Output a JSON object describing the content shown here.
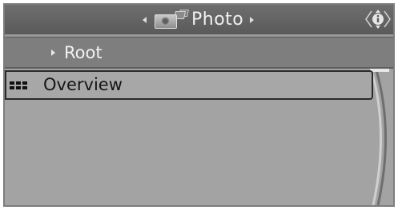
{
  "header": {
    "title": "Photo",
    "icon": "camera-with-cards-icon",
    "left_arrow_icon": "triangle-left-icon",
    "right_arrow_icon": "triangle-right-icon",
    "info_icon": "info-icon"
  },
  "breadcrumb": {
    "label": "Root",
    "icon": "triangle-right-icon"
  },
  "list": {
    "items": [
      {
        "label": "Overview",
        "icon": "grid-view-icon",
        "selected": true
      }
    ]
  },
  "colors": {
    "background": "#9a9a9a",
    "titlebar": "#5f5f5f",
    "breadcrumb_bar": "#7e7e7e",
    "selection_border": "#2a2a2a",
    "title_text": "#f0f0f0",
    "item_text": "#161616"
  }
}
